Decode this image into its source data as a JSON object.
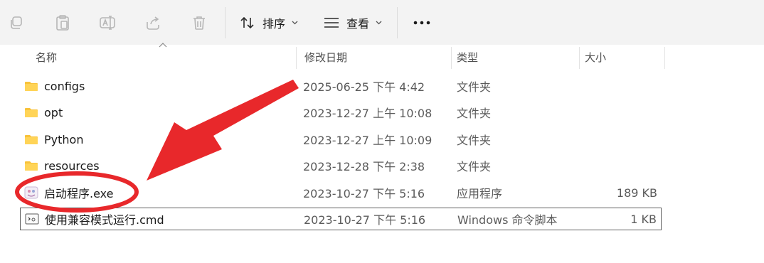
{
  "toolbar": {
    "sort_label": "排序",
    "view_label": "查看",
    "more_label": "···"
  },
  "columns": {
    "name": "名称",
    "modified": "修改日期",
    "type": "类型",
    "size": "大小"
  },
  "rows": [
    {
      "name": "configs",
      "modified": "2025-06-25 下午 4:42",
      "type": "文件夹",
      "size": "",
      "icon": "folder-icon"
    },
    {
      "name": "opt",
      "modified": "2023-12-27 上午 10:08",
      "type": "文件夹",
      "size": "",
      "icon": "folder-icon"
    },
    {
      "name": "Python",
      "modified": "2023-12-27 上午 10:09",
      "type": "文件夹",
      "size": "",
      "icon": "folder-icon"
    },
    {
      "name": "resources",
      "modified": "2023-12-28 下午 2:38",
      "type": "文件夹",
      "size": "",
      "icon": "folder-icon"
    },
    {
      "name": "启动程序.exe",
      "modified": "2023-10-27 下午 5:16",
      "type": "应用程序",
      "size": "189 KB",
      "icon": "application-icon"
    },
    {
      "name": "使用兼容模式运行.cmd",
      "modified": "2023-10-27 下午 5:16",
      "type": "Windows 命令脚本",
      "size": "1 KB",
      "icon": "script-icon"
    }
  ],
  "colors": {
    "folder": "#f8c23a",
    "annotation": "#e8282b",
    "toolbar_bg": "#f3f3f3"
  }
}
